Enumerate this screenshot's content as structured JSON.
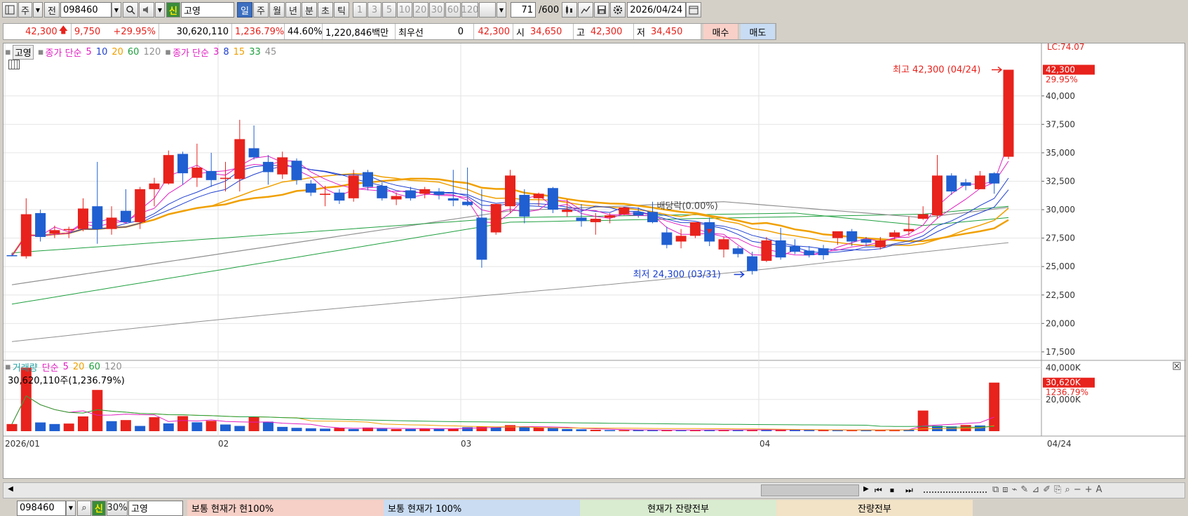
{
  "toolbar": {
    "period_main": "주",
    "period_prev": "전",
    "code": "098460",
    "badge": "신",
    "name": "고영",
    "periods": [
      {
        "label": "일",
        "active": true
      },
      {
        "label": "주",
        "active": false
      },
      {
        "label": "월",
        "active": false
      },
      {
        "label": "년",
        "active": false
      },
      {
        "label": "분",
        "active": false
      },
      {
        "label": "초",
        "active": false
      },
      {
        "label": "틱",
        "active": false
      }
    ],
    "intervals": [
      "1",
      "3",
      "5",
      "10",
      "20",
      "30",
      "60",
      "120"
    ],
    "count": "71",
    "count_total": "/600",
    "date": "2026/04/24"
  },
  "quote": {
    "price": "42,300",
    "change": "9,750",
    "change_pct": "+29.95%",
    "volume": "30,620,110",
    "volume_pct": "1,236.79%",
    "turnover_pct": "44.60%",
    "amount": "1,220,846백만",
    "best_label": "최우선",
    "best_qty": "0",
    "best_price": "42,300",
    "open_label": "시",
    "open": "34,650",
    "high_label": "고",
    "high": "42,300",
    "low_label": "저",
    "low": "34,450",
    "buy": "매수",
    "sell": "매도"
  },
  "legend": {
    "name": "고영",
    "ma_label": "종가 단순",
    "ma_periods": [
      "5",
      "10",
      "20",
      "60",
      "120"
    ],
    "ma2_label": "종가 단순",
    "ma2_periods": [
      "3",
      "8",
      "15",
      "33",
      "45"
    ],
    "vol_label": "거래량",
    "vol_ma_label": "단순",
    "vol_ma_periods": [
      "5",
      "20",
      "60",
      "120"
    ],
    "vol_text": "30,620,110주(1,236.79%)"
  },
  "colors": {
    "up": "#e8221c",
    "down": "#1f5fd1",
    "ma5": "#e020c0",
    "ma10": "#2040d0",
    "ma20": "#f0a000",
    "ma60": "#20a040",
    "ma120": "#909090"
  },
  "annotations": {
    "lc": "LC:74.07",
    "last_price": "42,300",
    "last_pct": "29.95%",
    "high_note": "최고 42,300 (04/24)",
    "low_note": "최저 24,300 (03/31)",
    "dividend_note": "배당락(0.00%)",
    "vol_last": "30,620K",
    "vol_pct": "1236.79%"
  },
  "price_axis": [
    "40,000",
    "37,500",
    "35,000",
    "32,500",
    "30,000",
    "27,500",
    "25,000",
    "22,500",
    "20,000",
    "17,500"
  ],
  "vol_axis": [
    "40,000K",
    "20,000K"
  ],
  "x_labels": [
    "2026/01",
    "02",
    "03",
    "04",
    "04/24"
  ],
  "chart_data": {
    "type": "candlestick",
    "ylim": [
      17500,
      42300
    ],
    "candles": [
      {
        "o": 26000,
        "h": 26200,
        "l": 25900,
        "c": 25950
      },
      {
        "o": 25900,
        "h": 31000,
        "l": 25700,
        "c": 29600
      },
      {
        "o": 29700,
        "h": 30000,
        "l": 27200,
        "c": 27600
      },
      {
        "o": 27900,
        "h": 28600,
        "l": 27500,
        "c": 28200
      },
      {
        "o": 28200,
        "h": 28500,
        "l": 27500,
        "c": 28300
      },
      {
        "o": 28300,
        "h": 31000,
        "l": 28100,
        "c": 30100
      },
      {
        "o": 30300,
        "h": 34200,
        "l": 27000,
        "c": 28300
      },
      {
        "o": 28300,
        "h": 30300,
        "l": 27800,
        "c": 29300
      },
      {
        "o": 29900,
        "h": 31800,
        "l": 28900,
        "c": 28900
      },
      {
        "o": 28900,
        "h": 32000,
        "l": 28300,
        "c": 31800
      },
      {
        "o": 31800,
        "h": 32800,
        "l": 30300,
        "c": 32300
      },
      {
        "o": 32300,
        "h": 35200,
        "l": 32200,
        "c": 34800
      },
      {
        "o": 34900,
        "h": 35100,
        "l": 32200,
        "c": 33200
      },
      {
        "o": 32800,
        "h": 35800,
        "l": 32000,
        "c": 33700
      },
      {
        "o": 33400,
        "h": 35000,
        "l": 32000,
        "c": 32600
      },
      {
        "o": 32700,
        "h": 34200,
        "l": 31600,
        "c": 32800
      },
      {
        "o": 32700,
        "h": 37900,
        "l": 31600,
        "c": 36200
      },
      {
        "o": 35400,
        "h": 37400,
        "l": 34400,
        "c": 34600
      },
      {
        "o": 34200,
        "h": 34800,
        "l": 32200,
        "c": 33300
      },
      {
        "o": 33100,
        "h": 35100,
        "l": 32700,
        "c": 34600
      },
      {
        "o": 34300,
        "h": 34500,
        "l": 32200,
        "c": 32600
      },
      {
        "o": 32300,
        "h": 32600,
        "l": 31200,
        "c": 31500
      },
      {
        "o": 31300,
        "h": 32100,
        "l": 30300,
        "c": 31400
      },
      {
        "o": 31500,
        "h": 31800,
        "l": 30500,
        "c": 30800
      },
      {
        "o": 31000,
        "h": 33500,
        "l": 30700,
        "c": 33000
      },
      {
        "o": 33300,
        "h": 33500,
        "l": 31700,
        "c": 32000
      },
      {
        "o": 32100,
        "h": 32400,
        "l": 30800,
        "c": 31000
      },
      {
        "o": 30900,
        "h": 31500,
        "l": 30400,
        "c": 31200
      },
      {
        "o": 31700,
        "h": 32000,
        "l": 30800,
        "c": 31000
      },
      {
        "o": 31400,
        "h": 32000,
        "l": 31000,
        "c": 31800
      },
      {
        "o": 31600,
        "h": 31900,
        "l": 30900,
        "c": 31300
      },
      {
        "o": 31000,
        "h": 33500,
        "l": 30300,
        "c": 30800
      },
      {
        "o": 30700,
        "h": 33700,
        "l": 30300,
        "c": 30400
      },
      {
        "o": 29300,
        "h": 31800,
        "l": 24900,
        "c": 25600
      },
      {
        "o": 28000,
        "h": 30500,
        "l": 27800,
        "c": 30500
      },
      {
        "o": 30300,
        "h": 33500,
        "l": 29700,
        "c": 33000
      },
      {
        "o": 31300,
        "h": 31800,
        "l": 28800,
        "c": 29400
      },
      {
        "o": 31000,
        "h": 31500,
        "l": 30300,
        "c": 31400
      },
      {
        "o": 31900,
        "h": 32000,
        "l": 29700,
        "c": 30000
      },
      {
        "o": 29800,
        "h": 30900,
        "l": 29400,
        "c": 30000
      },
      {
        "o": 29300,
        "h": 30500,
        "l": 28500,
        "c": 29000
      },
      {
        "o": 28900,
        "h": 29700,
        "l": 27800,
        "c": 29200
      },
      {
        "o": 29300,
        "h": 29700,
        "l": 28800,
        "c": 29500
      },
      {
        "o": 29600,
        "h": 30200,
        "l": 29500,
        "c": 30200
      },
      {
        "o": 29800,
        "h": 30200,
        "l": 29300,
        "c": 29500
      },
      {
        "o": 29800,
        "h": 30700,
        "l": 28800,
        "c": 28900
      },
      {
        "o": 28000,
        "h": 28500,
        "l": 26600,
        "c": 26900
      },
      {
        "o": 27200,
        "h": 28300,
        "l": 26600,
        "c": 27700
      },
      {
        "o": 27700,
        "h": 28600,
        "l": 27500,
        "c": 28900
      },
      {
        "o": 28900,
        "h": 29300,
        "l": 26800,
        "c": 27200
      },
      {
        "o": 26500,
        "h": 27600,
        "l": 25800,
        "c": 27400
      },
      {
        "o": 26600,
        "h": 26800,
        "l": 25800,
        "c": 26100
      },
      {
        "o": 25900,
        "h": 26300,
        "l": 24300,
        "c": 24600
      },
      {
        "o": 25500,
        "h": 27600,
        "l": 25400,
        "c": 27300
      },
      {
        "o": 27300,
        "h": 28400,
        "l": 25600,
        "c": 25800
      },
      {
        "o": 26800,
        "h": 27400,
        "l": 26100,
        "c": 26300
      },
      {
        "o": 26400,
        "h": 26800,
        "l": 25800,
        "c": 26000
      },
      {
        "o": 26600,
        "h": 26900,
        "l": 25600,
        "c": 26000
      },
      {
        "o": 27500,
        "h": 28000,
        "l": 26900,
        "c": 28100
      },
      {
        "o": 28100,
        "h": 28300,
        "l": 26800,
        "c": 27200
      },
      {
        "o": 27400,
        "h": 27600,
        "l": 26800,
        "c": 27100
      },
      {
        "o": 26700,
        "h": 27600,
        "l": 26500,
        "c": 27300
      },
      {
        "o": 27600,
        "h": 28200,
        "l": 27400,
        "c": 28000
      },
      {
        "o": 28100,
        "h": 29400,
        "l": 27700,
        "c": 28300
      },
      {
        "o": 29200,
        "h": 30300,
        "l": 29100,
        "c": 29600
      },
      {
        "o": 29500,
        "h": 34800,
        "l": 29200,
        "c": 33000
      },
      {
        "o": 33000,
        "h": 33200,
        "l": 31300,
        "c": 31600
      },
      {
        "o": 32400,
        "h": 32700,
        "l": 31700,
        "c": 32100
      },
      {
        "o": 31800,
        "h": 33400,
        "l": 31800,
        "c": 33000
      },
      {
        "o": 33200,
        "h": 33300,
        "l": 31400,
        "c": 32300
      },
      {
        "o": 34650,
        "h": 42300,
        "l": 34450,
        "c": 42300
      }
    ],
    "volume_ylim": [
      0,
      42000000
    ],
    "volumes": [
      {
        "v": 4500000,
        "up": true
      },
      {
        "v": 40000000,
        "up": true
      },
      {
        "v": 5500000,
        "up": false
      },
      {
        "v": 4500000,
        "up": false
      },
      {
        "v": 4800000,
        "up": true
      },
      {
        "v": 9300000,
        "up": true
      },
      {
        "v": 26000000,
        "up": true
      },
      {
        "v": 6300000,
        "up": false
      },
      {
        "v": 7000000,
        "up": true
      },
      {
        "v": 3300000,
        "up": false
      },
      {
        "v": 8800000,
        "up": true
      },
      {
        "v": 4900000,
        "up": false
      },
      {
        "v": 9500000,
        "up": true
      },
      {
        "v": 5600000,
        "up": false
      },
      {
        "v": 6500000,
        "up": true
      },
      {
        "v": 4200000,
        "up": false
      },
      {
        "v": 3300000,
        "up": false
      },
      {
        "v": 9000000,
        "up": true
      },
      {
        "v": 6000000,
        "up": false
      },
      {
        "v": 2700000,
        "up": false
      },
      {
        "v": 2100000,
        "up": false
      },
      {
        "v": 1800000,
        "up": false
      },
      {
        "v": 1600000,
        "up": false
      },
      {
        "v": 2100000,
        "up": true
      },
      {
        "v": 1400000,
        "up": false
      },
      {
        "v": 2300000,
        "up": true
      },
      {
        "v": 1700000,
        "up": false
      },
      {
        "v": 1300000,
        "up": true
      },
      {
        "v": 1400000,
        "up": false
      },
      {
        "v": 1600000,
        "up": true
      },
      {
        "v": 1800000,
        "up": false
      },
      {
        "v": 1700000,
        "up": true
      },
      {
        "v": 2500000,
        "up": false
      },
      {
        "v": 3000000,
        "up": true
      },
      {
        "v": 2400000,
        "up": false
      },
      {
        "v": 3800000,
        "up": true
      },
      {
        "v": 2700000,
        "up": false
      },
      {
        "v": 2200000,
        "up": true
      },
      {
        "v": 2100000,
        "up": false
      },
      {
        "v": 1400000,
        "up": false
      },
      {
        "v": 1200000,
        "up": false
      },
      {
        "v": 900000,
        "up": true
      },
      {
        "v": 700000,
        "up": false
      },
      {
        "v": 700000,
        "up": true
      },
      {
        "v": 800000,
        "up": false
      },
      {
        "v": 700000,
        "up": false
      },
      {
        "v": 700000,
        "up": true
      },
      {
        "v": 600000,
        "up": false
      },
      {
        "v": 800000,
        "up": true
      },
      {
        "v": 900000,
        "up": false
      },
      {
        "v": 800000,
        "up": true
      },
      {
        "v": 700000,
        "up": false
      },
      {
        "v": 900000,
        "up": true
      },
      {
        "v": 1100000,
        "up": false
      },
      {
        "v": 1000000,
        "up": true
      },
      {
        "v": 900000,
        "up": false
      },
      {
        "v": 700000,
        "up": false
      },
      {
        "v": 800000,
        "up": true
      },
      {
        "v": 600000,
        "up": false
      },
      {
        "v": 800000,
        "up": true
      },
      {
        "v": 700000,
        "up": false
      },
      {
        "v": 900000,
        "up": true
      },
      {
        "v": 1100000,
        "up": true
      },
      {
        "v": 1000000,
        "up": false
      },
      {
        "v": 13000000,
        "up": true
      },
      {
        "v": 3400000,
        "up": false
      },
      {
        "v": 3000000,
        "up": false
      },
      {
        "v": 3900000,
        "up": true
      },
      {
        "v": 3600000,
        "up": false
      },
      {
        "v": 30620110,
        "up": true
      }
    ]
  },
  "bottom": {
    "code": "098460",
    "badge": "신",
    "pct": "30%",
    "name": "고영",
    "panel1": "보통    현재가    현100%",
    "panel2": "보통    현재가    100%",
    "panel3": "현재가    잔량전부",
    "panel4": "잔량전부"
  }
}
